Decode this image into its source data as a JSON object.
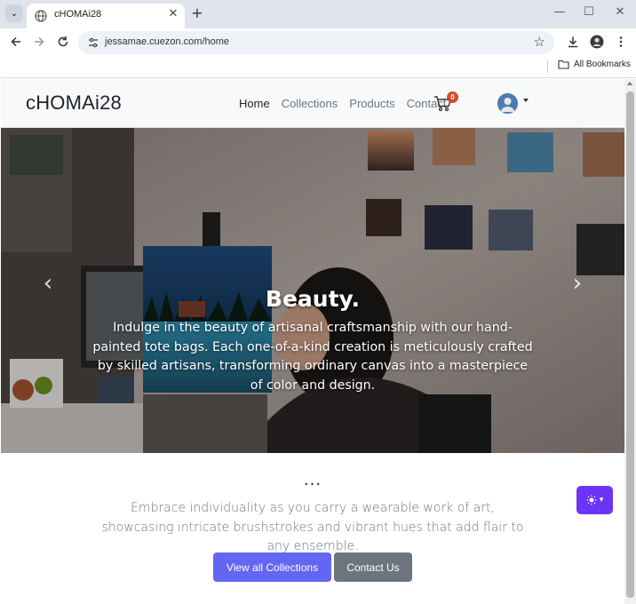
{
  "browser": {
    "tab_title": "cHOMAi28",
    "url": "jessamae.cuezon.com/home",
    "bookmarks_label": "All Bookmarks",
    "icons": [
      "tab-search-icon",
      "globe-icon",
      "close-icon",
      "plus-icon",
      "minimize-icon",
      "maximize-icon",
      "window-close-icon",
      "back-arrow-icon",
      "forward-arrow-icon",
      "reload-icon",
      "site-info-icon",
      "star-icon",
      "download-icon",
      "profile-icon",
      "kebab-menu-icon",
      "folder-icon"
    ]
  },
  "navbar": {
    "brand": "cHOMAi28",
    "links": [
      "Home",
      "Collections",
      "Products",
      "Contact"
    ],
    "active_link": "Home",
    "cart_count": "0"
  },
  "hero": {
    "title": "Beauty.",
    "text": "Indulge in the beauty of artisanal craftsmanship with our hand-painted tote bags. Each one-of-a-kind creation is meticulously crafted by skilled artisans, transforming ordinary canvas into a masterpiece of color and design.",
    "prev_label": "‹",
    "next_label": "›"
  },
  "content": {
    "dots": "...",
    "lead": "Embrace individuality as you carry a wearable work of art, showcasing intricate brushstrokes and vibrant hues that add flair to any ensemble.",
    "primary_button": "View all Collections",
    "secondary_button": "Contact Us"
  },
  "theme_toggle": {
    "icon": "sun-icon",
    "caret": "▾"
  },
  "colors": {
    "primary": "#6366f1",
    "secondary": "#6c757d",
    "badge": "#d24b2a",
    "theme_toggle": "#6a35f5"
  }
}
